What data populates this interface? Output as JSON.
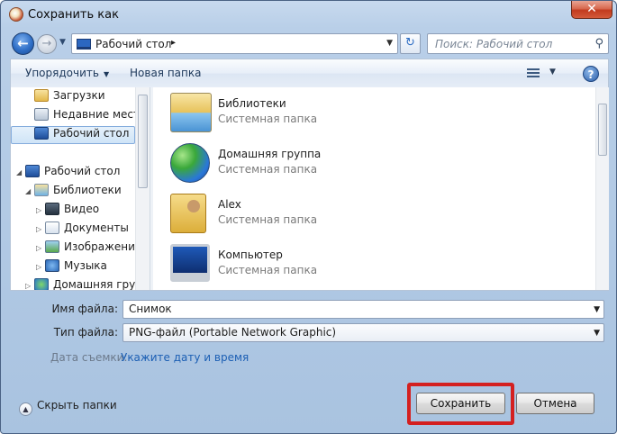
{
  "window": {
    "title": "Сохранить как",
    "close_glyph": "✕"
  },
  "nav": {
    "address": "Рабочий стол",
    "address_sep": "▸",
    "search_placeholder": "Поиск: Рабочий стол"
  },
  "toolbar": {
    "organize": "Упорядочить",
    "new_folder": "Новая папка",
    "help": "?"
  },
  "sidebar": {
    "items": [
      {
        "label": "Загрузки",
        "icon": "folder-icon"
      },
      {
        "label": "Недавние места",
        "icon": "recent-places-icon"
      },
      {
        "label": "Рабочий стол",
        "icon": "desktop-icon",
        "selected": true
      },
      {
        "label": "Рабочий стол",
        "icon": "desktop-icon"
      },
      {
        "label": "Библиотеки",
        "icon": "libraries-icon"
      },
      {
        "label": "Видео",
        "icon": "video-icon"
      },
      {
        "label": "Документы",
        "icon": "documents-icon"
      },
      {
        "label": "Изображения",
        "icon": "pictures-icon"
      },
      {
        "label": "Музыка",
        "icon": "music-icon"
      },
      {
        "label": "Домашняя группа",
        "icon": "homegroup-icon"
      }
    ]
  },
  "files": [
    {
      "name": "Библиотеки",
      "type": "Системная папка",
      "icon": "libraries-icon"
    },
    {
      "name": "Домашняя группа",
      "type": "Системная папка",
      "icon": "homegroup-icon"
    },
    {
      "name": "Alex",
      "type": "Системная папка",
      "icon": "user-folder-icon"
    },
    {
      "name": "Компьютер",
      "type": "Системная папка",
      "icon": "computer-icon"
    }
  ],
  "form": {
    "filename_label": "Имя файла:",
    "filename_value": "Снимок",
    "filetype_label": "Тип файла:",
    "filetype_value": "PNG-файл (Portable Network Graphic)",
    "date_label": "Дата съемки:",
    "date_link": "Укажите дату и время"
  },
  "footer": {
    "hide_folders": "Скрыть папки",
    "save": "Сохранить",
    "cancel": "Отмена"
  },
  "colors": {
    "highlight": "#d42020",
    "link": "#1c5fb4"
  }
}
